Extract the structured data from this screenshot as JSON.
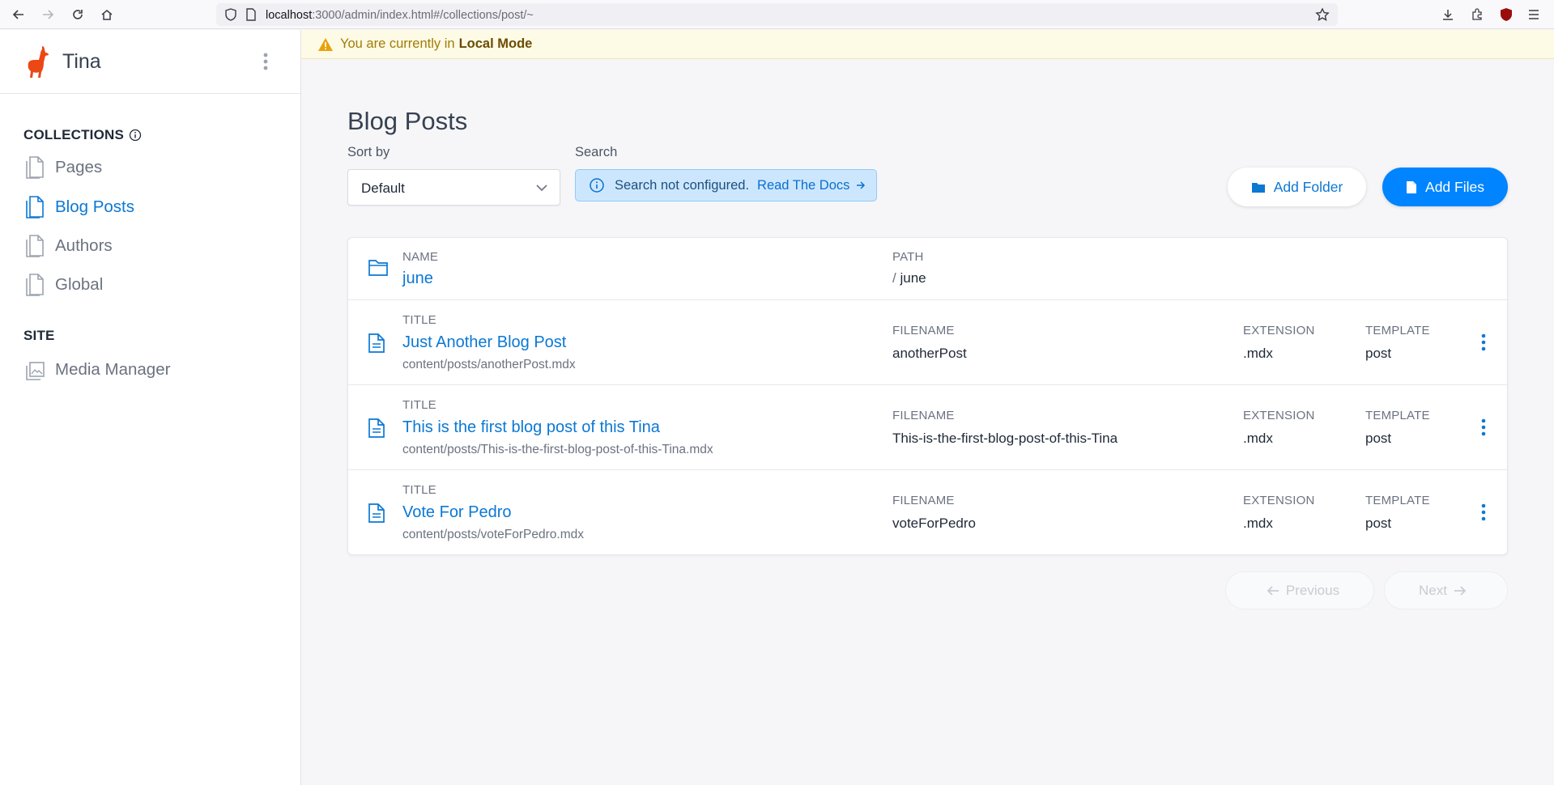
{
  "browser": {
    "url_host": "localhost",
    "url_rest": ":3000/admin/index.html#/collections/post/~"
  },
  "sidebar": {
    "brand": "Tina",
    "collections_label": "COLLECTIONS",
    "collections": [
      {
        "label": "Pages",
        "active": false
      },
      {
        "label": "Blog Posts",
        "active": true
      },
      {
        "label": "Authors",
        "active": false
      },
      {
        "label": "Global",
        "active": false
      }
    ],
    "site_label": "SITE",
    "site_items": [
      {
        "label": "Media Manager"
      }
    ]
  },
  "banner": {
    "text": "You are currently in",
    "mode": "Local Mode"
  },
  "main": {
    "title": "Blog Posts",
    "sort_label": "Sort by",
    "sort_value": "Default",
    "search_label": "Search",
    "search_note": "Search not configured.",
    "search_link": "Read The Docs",
    "add_folder": "Add Folder",
    "add_files": "Add Files"
  },
  "table": {
    "folder": {
      "name_header": "NAME",
      "name": "june",
      "path_header": "PATH",
      "path_sep": "/",
      "path": "june"
    },
    "headers": {
      "title": "TITLE",
      "filename": "FILENAME",
      "extension": "EXTENSION",
      "template": "TEMPLATE"
    },
    "rows": [
      {
        "title": "Just Another Blog Post",
        "path": "content/posts/anotherPost.mdx",
        "filename": "anotherPost",
        "extension": ".mdx",
        "template": "post"
      },
      {
        "title": "This is the first blog post of this Tina",
        "path": "content/posts/This-is-the-first-blog-post-of-this-Tina.mdx",
        "filename": "This-is-the-first-blog-post-of-this-Tina",
        "extension": ".mdx",
        "template": "post"
      },
      {
        "title": "Vote For Pedro",
        "path": "content/posts/voteForPedro.mdx",
        "filename": "voteForPedro",
        "extension": ".mdx",
        "template": "post"
      }
    ]
  },
  "pagination": {
    "previous": "Previous",
    "next": "Next"
  },
  "colors": {
    "accent": "#0084ff",
    "link": "#0b78d4",
    "brand_llama": "#ec4815",
    "banner_bg": "#fdfae6"
  }
}
